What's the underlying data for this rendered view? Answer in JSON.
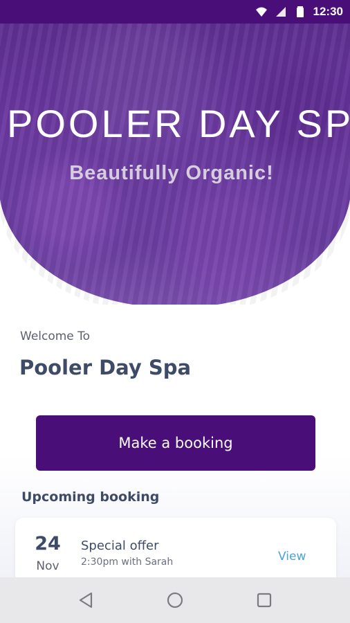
{
  "status_bar": {
    "time": "12:30",
    "icons": [
      "wifi-icon",
      "signal-icon",
      "battery-icon"
    ]
  },
  "hero": {
    "title": "POOLER DAY SPA",
    "subtitle": "Beautifully Organic!"
  },
  "welcome": {
    "label": "Welcome To",
    "spa_name": "Pooler Day Spa"
  },
  "actions": {
    "booking_button": "Make a booking"
  },
  "upcoming": {
    "title": "Upcoming booking",
    "items": [
      {
        "day": "24",
        "month": "Nov",
        "title": "Special offer",
        "detail": "2:30pm with Sarah",
        "action": "View"
      }
    ]
  },
  "nav": {
    "icons": [
      "back-icon",
      "home-icon",
      "recents-icon"
    ]
  },
  "colors": {
    "primary": "#4a0e78",
    "heading": "#3d4b66",
    "link": "#4ba1d8"
  }
}
